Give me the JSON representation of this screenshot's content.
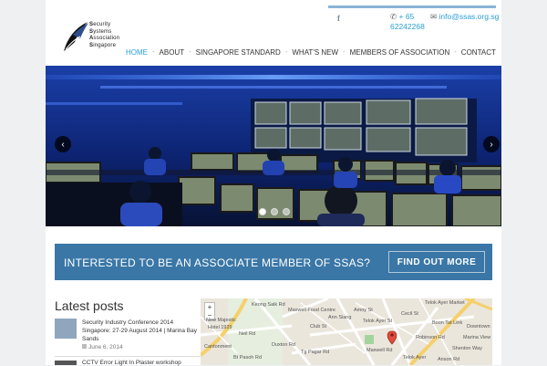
{
  "header": {
    "logo_lines": [
      "Security",
      "Systems",
      "Association",
      "Singapore"
    ],
    "facebook_icon": "f",
    "phone_icon": "phone-icon",
    "phone_lines": [
      "+ 65",
      "62242268"
    ],
    "email_icon": "envelope-icon",
    "email": "info@ssas.org.sg"
  },
  "nav": {
    "items": [
      {
        "label": "HOME",
        "active": true
      },
      {
        "label": "ABOUT"
      },
      {
        "label": "SINGAPORE STANDARD"
      },
      {
        "label": "WHAT'S NEW"
      },
      {
        "label": "MEMBERS OF ASSOCIATION"
      },
      {
        "label": "CONTACT"
      }
    ],
    "separator": "-"
  },
  "slider": {
    "prev": "‹",
    "next": "›",
    "slides": 3,
    "current": 1
  },
  "banner": {
    "text": "INTERESTED TO BE AN ASSOCIATE MEMBER OF SSAS?",
    "button": "FIND OUT MORE"
  },
  "posts": {
    "title": "Latest posts",
    "items": [
      {
        "title": "Security Industry Conference 2014 Singapore: 27-29 August 2014 | Marina Bay Sands",
        "date": "June 6, 2014"
      },
      {
        "title": "CCTV Error Light In Plaster workshop"
      }
    ]
  },
  "map": {
    "zoom_in": "+",
    "zoom_out": "−",
    "labels": [
      "Telok Ayer Market",
      "Maxwell Food Centre",
      "New Majestic",
      "Downtown",
      "Hotel 1929",
      "Neil Rd",
      "Ann Siang",
      "Amoy St",
      "Telok Ayer St",
      "Cecil St",
      "Cantonment",
      "Duxton Rd",
      "Maxwell Rd",
      "Robinson Rd",
      "Shenton Way",
      "Boon Tat Link",
      "Marina View",
      "Telok Ayer",
      "Bt Pasoh Rd",
      "Club St",
      "Keong Saik Rd",
      "Tg Pagar Rd",
      "Anson Rd"
    ]
  }
}
